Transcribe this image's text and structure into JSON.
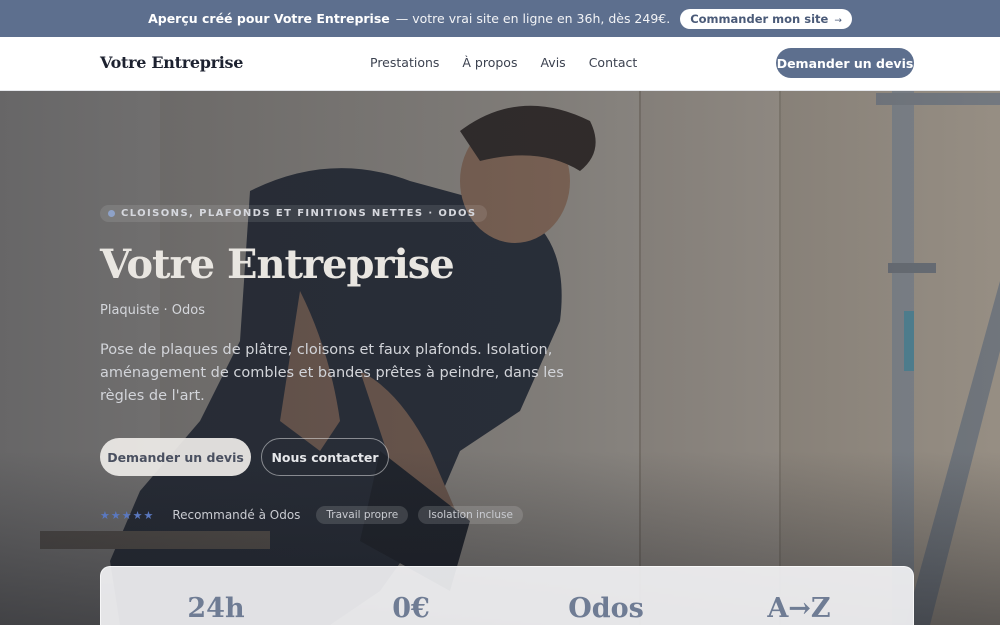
{
  "topbar": {
    "brand": "Aperçu créé pour Votre Entreprise",
    "text": "— votre vrai site en ligne en 36h, dès 249€.",
    "cta_label": "Commander mon site",
    "cta_arrow": "→"
  },
  "nav": {
    "logo": "Votre Entreprise",
    "links": [
      "Prestations",
      "À propos",
      "Avis",
      "Contact"
    ],
    "cta_label": "Demander un devis"
  },
  "hero": {
    "kicker": "CLOISONS, PLAFONDS ET FINITIONS NETTES · ODOS",
    "title": "Votre Entreprise",
    "subtitle": "Plaquiste · Odos",
    "description": "Pose de plaques de plâtre, cloisons et faux plafonds. Isolation, aménagement de combles et bandes prêtes à peindre, dans les règles de l'art.",
    "primary_cta": "Demander un devis",
    "secondary_cta": "Nous contacter",
    "rating_stars": "★★★★★",
    "rating_text": "Recommandé à Odos",
    "tags": [
      "Travail propre",
      "Isolation incluse"
    ]
  },
  "stats": [
    "24h",
    "0€",
    "Odos",
    "A→Z"
  ],
  "colors": {
    "accent": "#5d6f8e",
    "nav_background": "#ffffff",
    "hero_overlay": "#23262e",
    "star": "#5a78c0"
  },
  "icons": {
    "kicker_dot": "dot-icon",
    "rating": "star-icon",
    "cta_arrow": "arrow-right-icon"
  }
}
